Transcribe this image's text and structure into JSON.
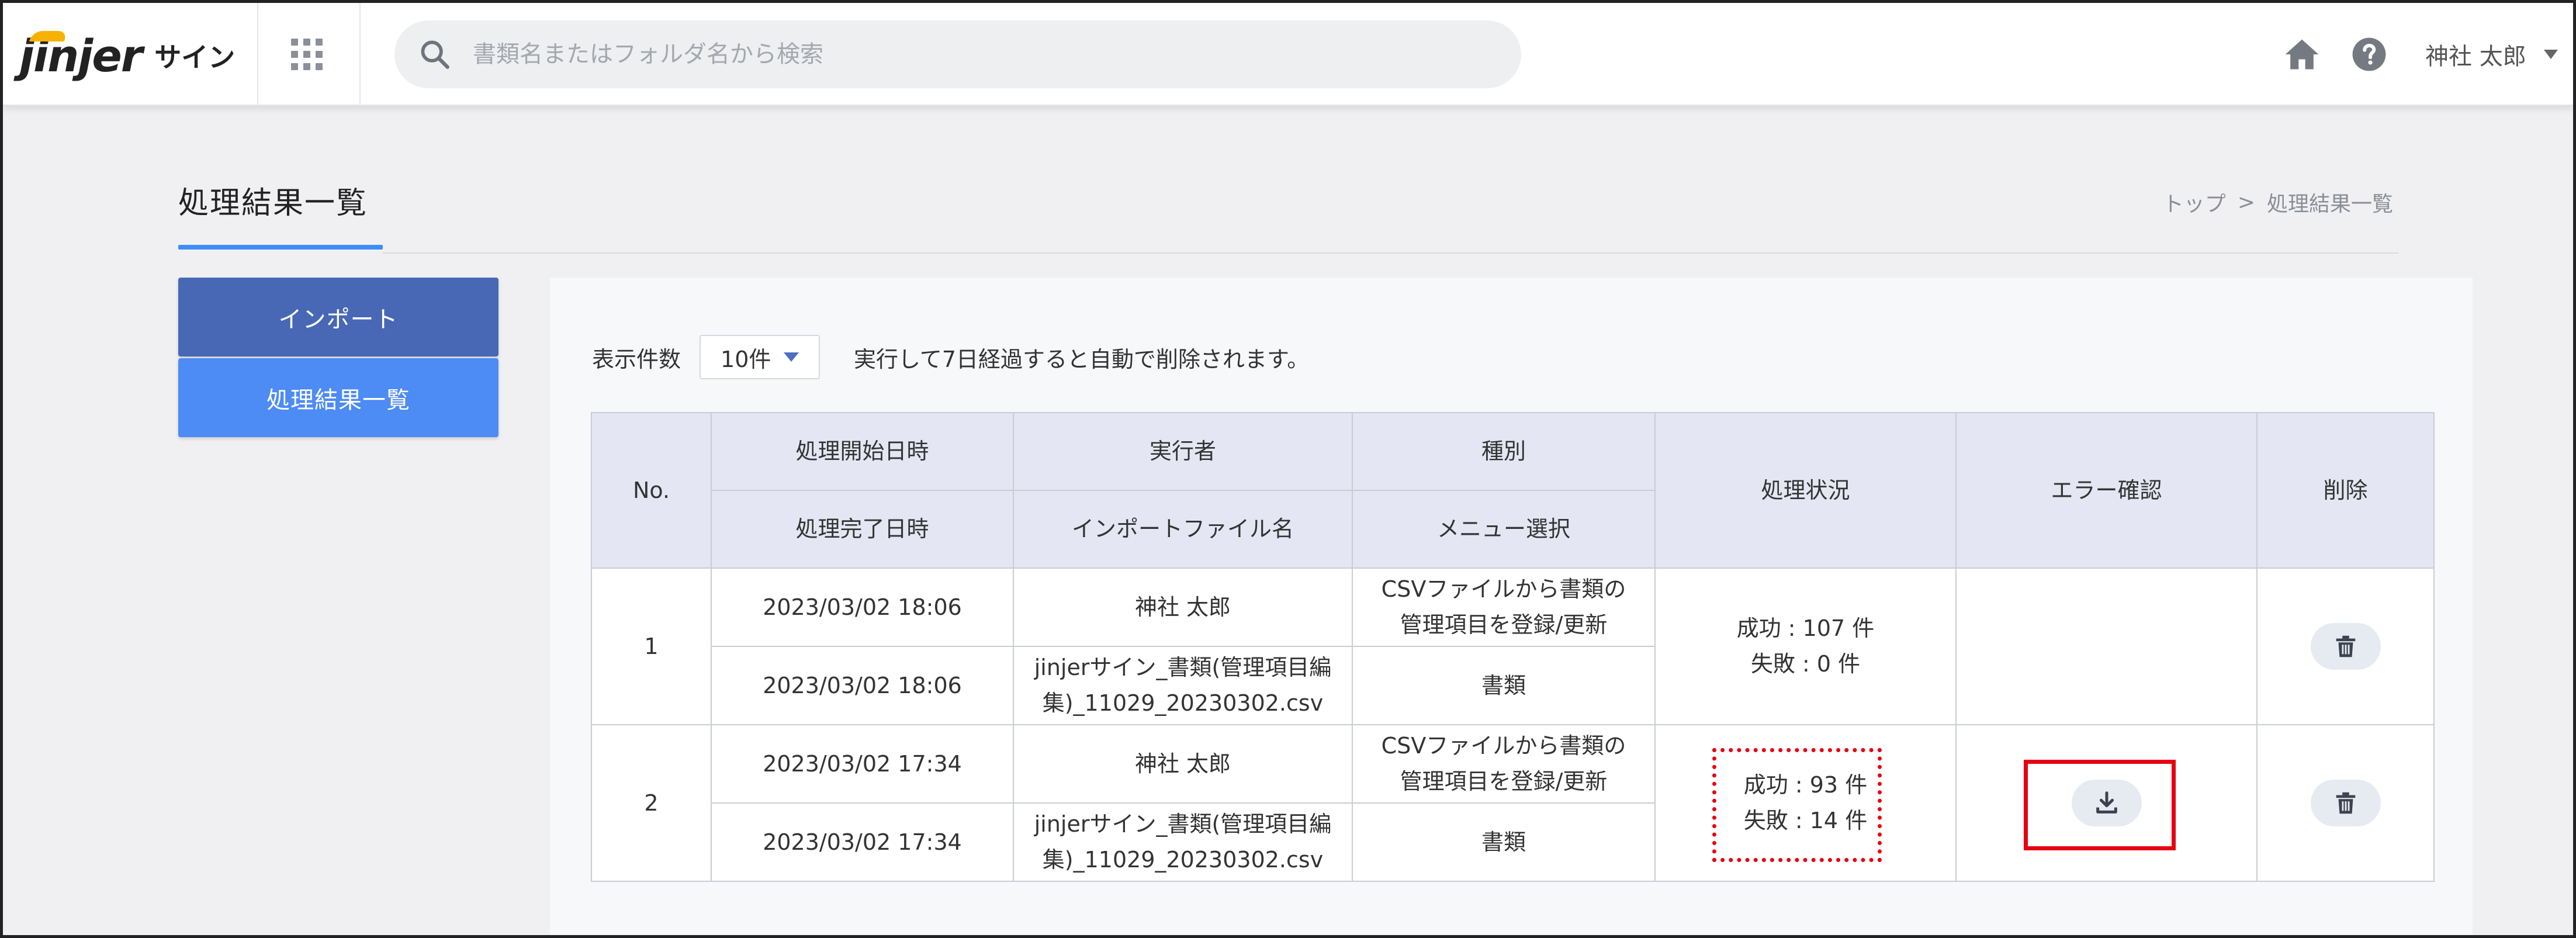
{
  "header": {
    "logo_mark": "jinjer",
    "logo_sub": "サイン",
    "search_placeholder": "書類名またはフォルダ名から検索",
    "user_name": "神社 太郎"
  },
  "page": {
    "title": "処理結果一覧",
    "breadcrumb": [
      "トップ",
      ">",
      "処理結果一覧"
    ]
  },
  "sidebar": {
    "items": [
      {
        "label": "インポート",
        "active": false
      },
      {
        "label": "処理結果一覧",
        "active": true
      }
    ]
  },
  "toolbar": {
    "per_page_label": "表示件数",
    "per_page_value": "10件",
    "notice": "実行して7日経過すると自動で削除されます。"
  },
  "table": {
    "headers": {
      "no": "No.",
      "start": "処理開始日時",
      "end": "処理完了日時",
      "executor": "実行者",
      "file": "インポートファイル名",
      "kind": "種別",
      "menu": "メニュー選択",
      "status": "処理状況",
      "error": "エラー確認",
      "delete": "削除"
    },
    "rows": [
      {
        "no": "1",
        "start": "2023/03/02 18:06",
        "end": "2023/03/02 18:06",
        "executor": "神社 太郎",
        "file_line1": "jinjerサイン_書類(管理項目編",
        "file_line2": "集)_11029_20230302.csv",
        "kind_line1": "CSVファイルから書類の",
        "kind_line2": "管理項目を登録/更新",
        "menu": "書類",
        "success": "成功 : 107 件",
        "failure": "失敗 : 0 件",
        "has_error_download": false
      },
      {
        "no": "2",
        "start": "2023/03/02 17:34",
        "end": "2023/03/02 17:34",
        "executor": "神社 太郎",
        "file_line1": "jinjerサイン_書類(管理項目編",
        "file_line2": "集)_11029_20230302.csv",
        "kind_line1": "CSVファイルから書類の",
        "kind_line2": "管理項目を登録/更新",
        "menu": "書類",
        "success": "成功 : 93 件",
        "failure": "失敗 : 14 件",
        "has_error_download": true
      }
    ]
  },
  "colors": {
    "accent": "#3d8cff",
    "sidebar_import": "#4868b5",
    "sidebar_active": "#4d8bf5",
    "table_header": "#e4e7f3",
    "highlight": "#e60012",
    "logo_accent": "#f6b200"
  },
  "icons": [
    "apps-grid-icon",
    "search-icon",
    "home-icon",
    "help-icon",
    "chevron-down-icon",
    "download-icon",
    "trash-icon"
  ]
}
